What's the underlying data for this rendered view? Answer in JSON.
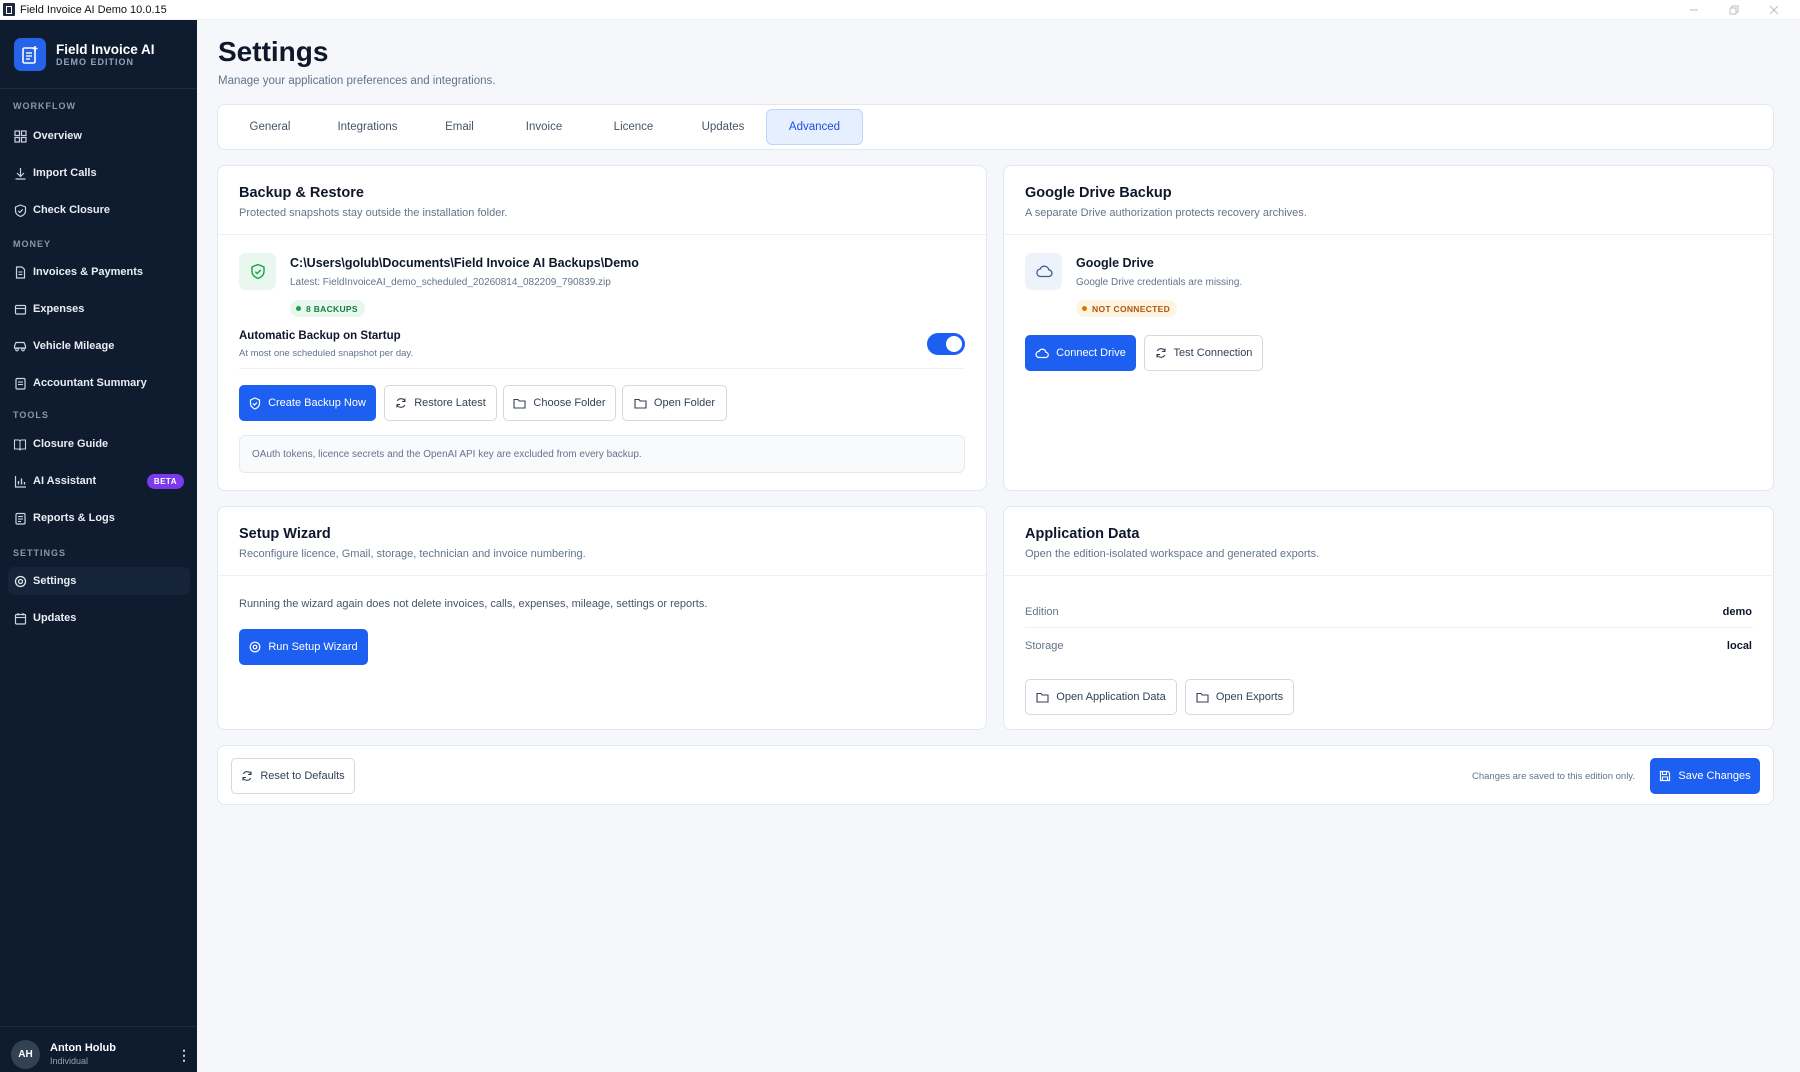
{
  "window": {
    "title": "Field Invoice AI Demo 10.0.15"
  },
  "brand": {
    "name": "Field Invoice AI",
    "edition": "DEMO EDITION"
  },
  "sidebar": {
    "sections": {
      "workflow": "WORKFLOW",
      "money": "MONEY",
      "tools": "TOOLS",
      "settings": "SETTINGS"
    },
    "items": [
      {
        "label": "Overview",
        "icon": "grid-icon"
      },
      {
        "label": "Import Calls",
        "icon": "download-icon"
      },
      {
        "label": "Check Closure",
        "icon": "shield-check-icon"
      },
      {
        "label": "Invoices & Payments",
        "icon": "document-icon"
      },
      {
        "label": "Expenses",
        "icon": "wallet-icon"
      },
      {
        "label": "Vehicle Mileage",
        "icon": "car-icon"
      },
      {
        "label": "Accountant Summary",
        "icon": "clipboard-icon"
      },
      {
        "label": "Closure Guide",
        "icon": "book-icon"
      },
      {
        "label": "AI Assistant",
        "icon": "bar-chart-icon",
        "badge": "BETA"
      },
      {
        "label": "Reports & Logs",
        "icon": "report-icon"
      },
      {
        "label": "Settings",
        "icon": "gear-icon",
        "active": true
      },
      {
        "label": "Updates",
        "icon": "calendar-icon"
      }
    ]
  },
  "user": {
    "initials": "AH",
    "name": "Anton Holub",
    "role": "Individual"
  },
  "page": {
    "title": "Settings",
    "subtitle": "Manage your application preferences and integrations."
  },
  "tabs": [
    {
      "label": "General"
    },
    {
      "label": "Integrations"
    },
    {
      "label": "Email"
    },
    {
      "label": "Invoice"
    },
    {
      "label": "Licence"
    },
    {
      "label": "Updates"
    },
    {
      "label": "Advanced",
      "active": true
    }
  ],
  "backup": {
    "title": "Backup & Restore",
    "subtitle": "Protected snapshots stay outside the installation folder.",
    "path": "C:\\Users\\golub\\Documents\\Field Invoice AI Backups\\Demo",
    "latest": "Latest: FieldInvoiceAI_demo_scheduled_20260814_082209_790839.zip",
    "badge": "8 BACKUPS",
    "auto_label": "Automatic Backup on Startup",
    "auto_desc": "At most one scheduled snapshot per day.",
    "auto_enabled": true,
    "buttons": {
      "create": "Create Backup Now",
      "restore": "Restore Latest",
      "choose": "Choose Folder",
      "open": "Open Folder"
    },
    "note": "OAuth tokens, licence secrets and the OpenAI API key are excluded from every backup."
  },
  "gdrive": {
    "title": "Google Drive Backup",
    "subtitle": "A separate Drive authorization protects recovery archives.",
    "name": "Google Drive",
    "desc": "Google Drive credentials are missing.",
    "status": "NOT CONNECTED",
    "buttons": {
      "connect": "Connect Drive",
      "test": "Test Connection"
    }
  },
  "wizard": {
    "title": "Setup Wizard",
    "subtitle": "Reconfigure licence, Gmail, storage, technician and invoice numbering.",
    "body": "Running the wizard again does not delete invoices, calls, expenses, mileage, settings or reports.",
    "button": "Run Setup Wizard"
  },
  "appdata": {
    "title": "Application Data",
    "subtitle": "Open the edition-isolated workspace and generated exports.",
    "rows": [
      {
        "label": "Edition",
        "value": "demo"
      },
      {
        "label": "Storage",
        "value": "local"
      }
    ],
    "buttons": {
      "open_data": "Open Application Data",
      "open_exports": "Open Exports"
    }
  },
  "footer": {
    "reset": "Reset to Defaults",
    "note": "Changes are saved to this edition only.",
    "save": "Save Changes"
  },
  "colors": {
    "primary": "#1d5ff0",
    "sidebar": "#0f1b2e",
    "success": "#16a34a",
    "warning": "#d97706",
    "beta": "#7c3aed"
  }
}
